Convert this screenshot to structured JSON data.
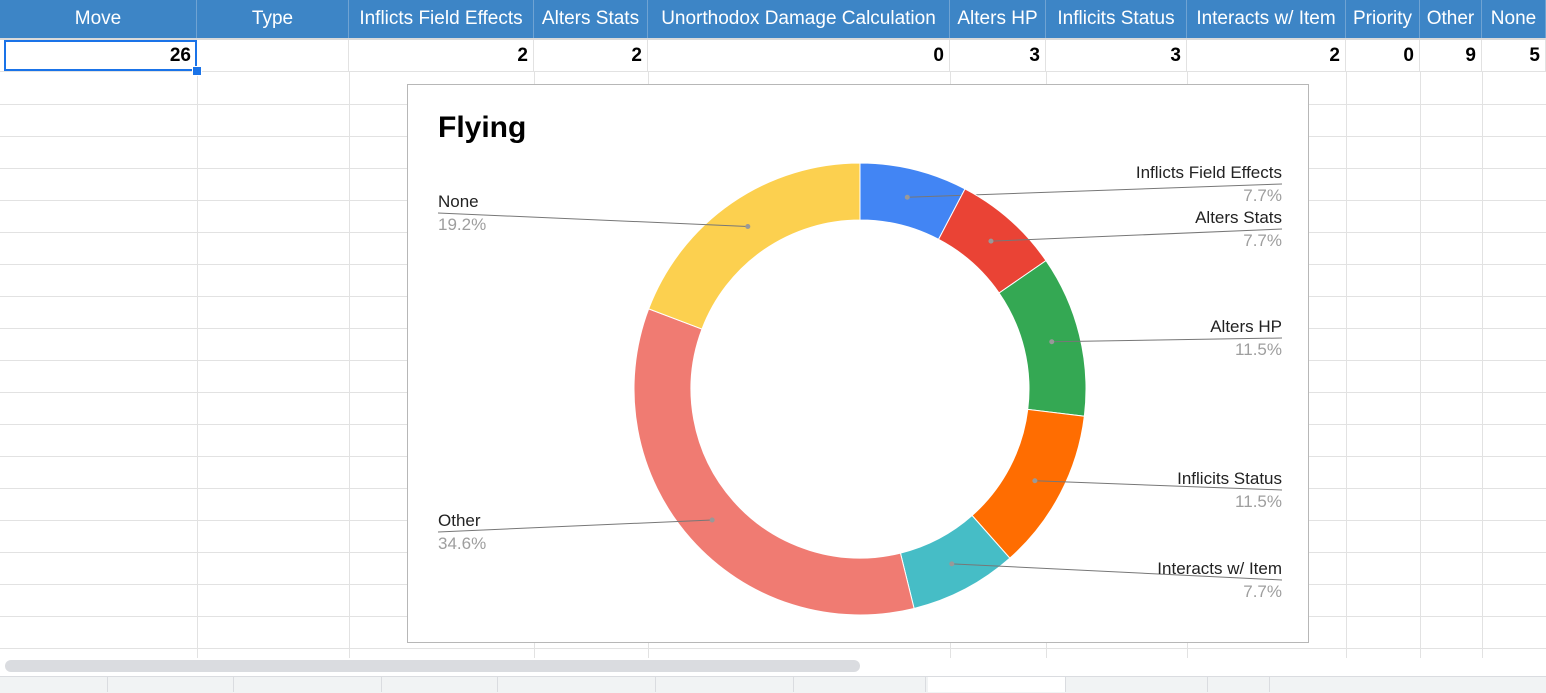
{
  "sheet": {
    "headers": [
      "Move",
      "Type",
      "Inflicts Field Effects",
      "Alters Stats",
      "Unorthodox Damage Calculation",
      "Alters HP",
      "Inflicits Status",
      "Interacts w/ Item",
      "Priority",
      "Other",
      "None"
    ],
    "row": [
      "26",
      "",
      "2",
      "2",
      "0",
      "3",
      "3",
      "2",
      "0",
      "9",
      "5"
    ]
  },
  "colors": {
    "header_bg": "#3d85c6",
    "selection": "#1a73e8"
  },
  "chart_data": {
    "type": "pie",
    "donut": true,
    "title": "Flying",
    "legend": "labels",
    "slices": [
      {
        "label": "Inflicts Field Effects",
        "pct_label": "7.7%",
        "value": 2,
        "color": "#4285f4"
      },
      {
        "label": "Alters Stats",
        "pct_label": "7.7%",
        "value": 2,
        "color": "#ea4335"
      },
      {
        "label": "Unorthodox Damage Calculation",
        "pct_label": "",
        "value": 0,
        "color": "#fbbc04"
      },
      {
        "label": "Alters HP",
        "pct_label": "11.5%",
        "value": 3,
        "color": "#34a853"
      },
      {
        "label": "Inflicits Status",
        "pct_label": "11.5%",
        "value": 3,
        "color": "#ff6d01"
      },
      {
        "label": "Interacts w/ Item",
        "pct_label": "7.7%",
        "value": 2,
        "color": "#46bdc6"
      },
      {
        "label": "Priority",
        "pct_label": "",
        "value": 0,
        "color": "#7baaf7"
      },
      {
        "label": "Other",
        "pct_label": "34.6%",
        "value": 9,
        "color": "#f07b72"
      },
      {
        "label": "None",
        "pct_label": "19.2%",
        "value": 5,
        "color": "#fcd04f"
      }
    ]
  }
}
